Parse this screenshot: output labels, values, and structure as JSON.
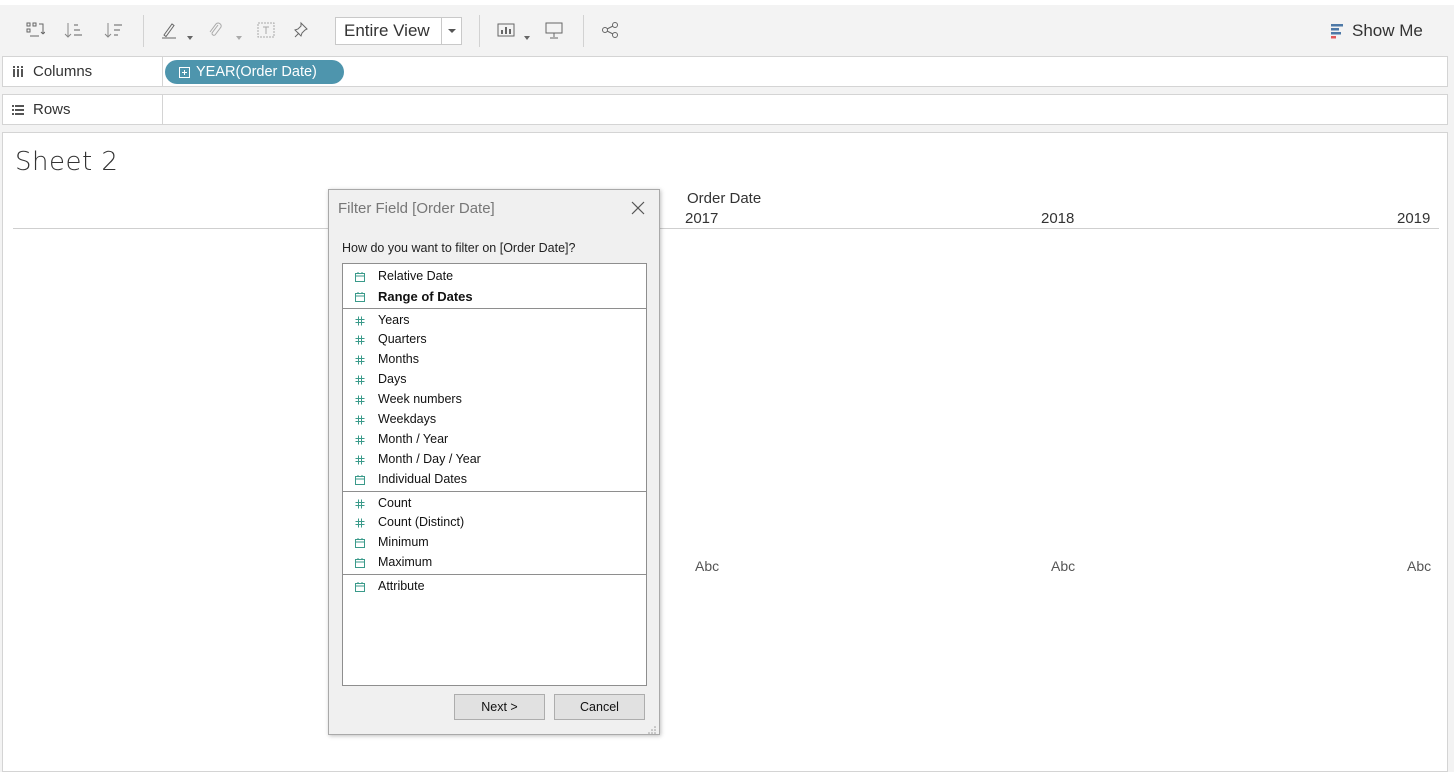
{
  "toolbar": {
    "fit": "Entire View",
    "show_me": "Show Me"
  },
  "shelves": {
    "columns_label": "Columns",
    "columns_pill": "YEAR(Order Date)",
    "rows_label": "Rows"
  },
  "sheet": {
    "title": "Sheet 2",
    "column_header": "Order Date",
    "years": [
      "2017",
      "2018",
      "2019"
    ],
    "cell_text": "Abc"
  },
  "dialog": {
    "title": "Filter Field [Order Date]",
    "question": "How do you want to filter on [Order Date]?",
    "items": [
      {
        "label": "Relative Date",
        "icon": "calendar-icon"
      },
      {
        "label": "Range of Dates",
        "icon": "calendar-icon",
        "selected": true
      },
      {
        "label": "Years",
        "icon": "hash-icon"
      },
      {
        "label": "Quarters",
        "icon": "hash-icon"
      },
      {
        "label": "Months",
        "icon": "hash-icon"
      },
      {
        "label": "Days",
        "icon": "hash-icon"
      },
      {
        "label": "Week numbers",
        "icon": "hash-icon"
      },
      {
        "label": "Weekdays",
        "icon": "hash-icon"
      },
      {
        "label": "Month / Year",
        "icon": "hash-icon"
      },
      {
        "label": "Month / Day / Year",
        "icon": "hash-icon"
      },
      {
        "label": "Individual Dates",
        "icon": "calendar-icon"
      },
      {
        "label": "Count",
        "icon": "hash-icon"
      },
      {
        "label": "Count (Distinct)",
        "icon": "hash-icon"
      },
      {
        "label": "Minimum",
        "icon": "calendar-icon"
      },
      {
        "label": "Maximum",
        "icon": "calendar-icon"
      },
      {
        "label": "Attribute",
        "icon": "calendar-icon"
      }
    ],
    "next_button": "Next >",
    "cancel_button": "Cancel"
  },
  "colors": {
    "pill": "#4e95ad",
    "icon_teal": "#3a9a8a",
    "show_me_accent": "#e15759"
  }
}
